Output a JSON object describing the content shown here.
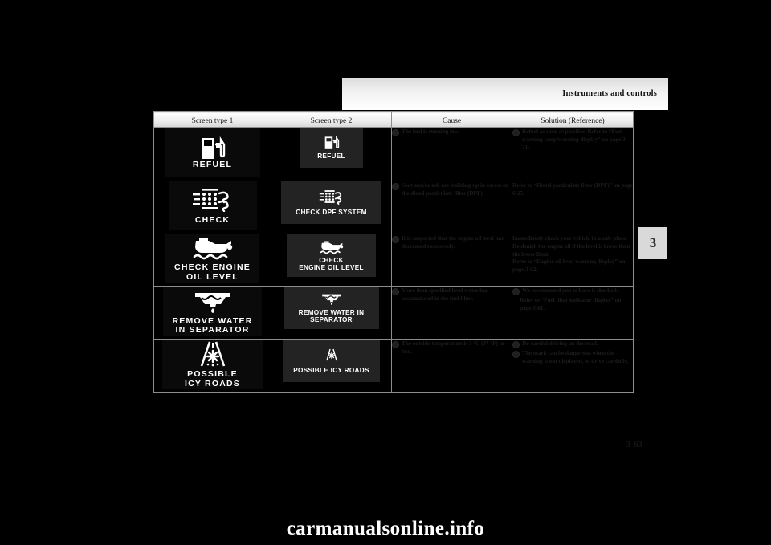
{
  "document": {
    "header_title": "Instruments and controls",
    "chapter_tab": "3",
    "page_number": "3-63",
    "watermark": "carmanualsonline.info"
  },
  "table": {
    "columns": [
      {
        "label": "Screen type 1"
      },
      {
        "label": "Screen type 2"
      },
      {
        "label": "Cause"
      },
      {
        "label": "Solution (Reference)"
      }
    ],
    "rows": [
      {
        "id": "refuel",
        "screen1": {
          "icon": "fuel-pump-icon",
          "label": "REFUEL"
        },
        "screen2": {
          "icon": "fuel-pump-icon",
          "label": "REFUEL"
        },
        "cause": [
          {
            "bullet": true,
            "text": "The fuel is running low."
          }
        ],
        "solution": [
          {
            "bullet": true,
            "text": "Refuel as soon as possible. Refer to “Fuel warning lamp/warning display” on page 3-31."
          }
        ]
      },
      {
        "id": "check-dpf-system",
        "screen1": {
          "icon": "dpf-filter-icon",
          "label": "CHECK"
        },
        "screen2": {
          "icon": "dpf-filter-icon",
          "label": "CHECK DPF SYSTEM"
        },
        "cause": [
          {
            "bullet": true,
            "text": "Soot and/or ash are building up in excess in the diesel particulate filter (DPF)."
          }
        ],
        "solution": [
          {
            "bullet": false,
            "text": "Refer to “Diesel particulate filter (DPF)” on page 6-25."
          }
        ]
      },
      {
        "id": "check-engine-oil-level",
        "screen1": {
          "icon": "oil-can-level-icon",
          "label": "CHECK ENGINE\nOIL LEVEL"
        },
        "screen2": {
          "icon": "oil-can-level-icon",
          "label": "CHECK\nENGINE OIL LEVEL"
        },
        "cause": [
          {
            "bullet": true,
            "text": "It is suspected that the engine oil level has decreased excessively."
          }
        ],
        "solution": [
          {
            "bullet": false,
            "text": "Immediately check your vehicle in a safe place. Replenish the engine oil if the level is lower than the lower limit."
          },
          {
            "bullet": false,
            "text": "Refer to “Engine oil level warning display” on page 3-62."
          }
        ]
      },
      {
        "id": "remove-water-in-separator",
        "screen1": {
          "icon": "water-separator-icon",
          "label": "REMOVE  WATER\nIN  SEPARATOR"
        },
        "screen2": {
          "icon": "water-separator-icon",
          "label": "REMOVE WATER IN\nSEPARATOR"
        },
        "cause": [
          {
            "bullet": true,
            "text": "More than specified level water has accumulated in the fuel filter."
          }
        ],
        "solution": [
          {
            "bullet": true,
            "text": "We recommend you to have it checked."
          },
          {
            "bullet": false,
            "text": "Refer to “Fuel filter indicator display” on page 3-61."
          }
        ]
      },
      {
        "id": "possible-icy-roads",
        "screen1": {
          "icon": "icy-road-snowflake-icon",
          "label": "POSSIBLE\nICY ROADS"
        },
        "screen2": {
          "icon": "icy-road-snowflake-icon",
          "label": "POSSIBLE ICY ROADS"
        },
        "cause": [
          {
            "bullet": true,
            "text": "The outside temperature is 3 °C (37 °F) or less."
          }
        ],
        "solution": [
          {
            "bullet": true,
            "text": "Do careful driving on the road."
          },
          {
            "bullet": true,
            "text": "The mark can be dangerous when the warning is not displayed, so drive carefully."
          }
        ]
      }
    ]
  }
}
